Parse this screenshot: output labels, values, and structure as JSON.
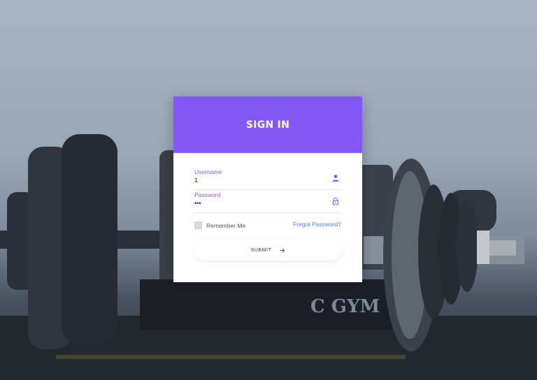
{
  "login": {
    "title": "SIGN IN",
    "username_label": "Username",
    "username_value": "1",
    "password_label": "Password",
    "password_value": "•••",
    "remember_label": "Remember Me",
    "forgot_label": "Forgot Password?",
    "submit_label": "SUBMIT"
  },
  "background": {
    "gym_text": "C GYM"
  },
  "colors": {
    "header": "#8457f7",
    "label": "#8c5cf6",
    "link": "#5b7cf0"
  },
  "icons": {
    "user": "user-icon",
    "lock": "lock-icon",
    "arrow": "arrow-right-icon"
  }
}
